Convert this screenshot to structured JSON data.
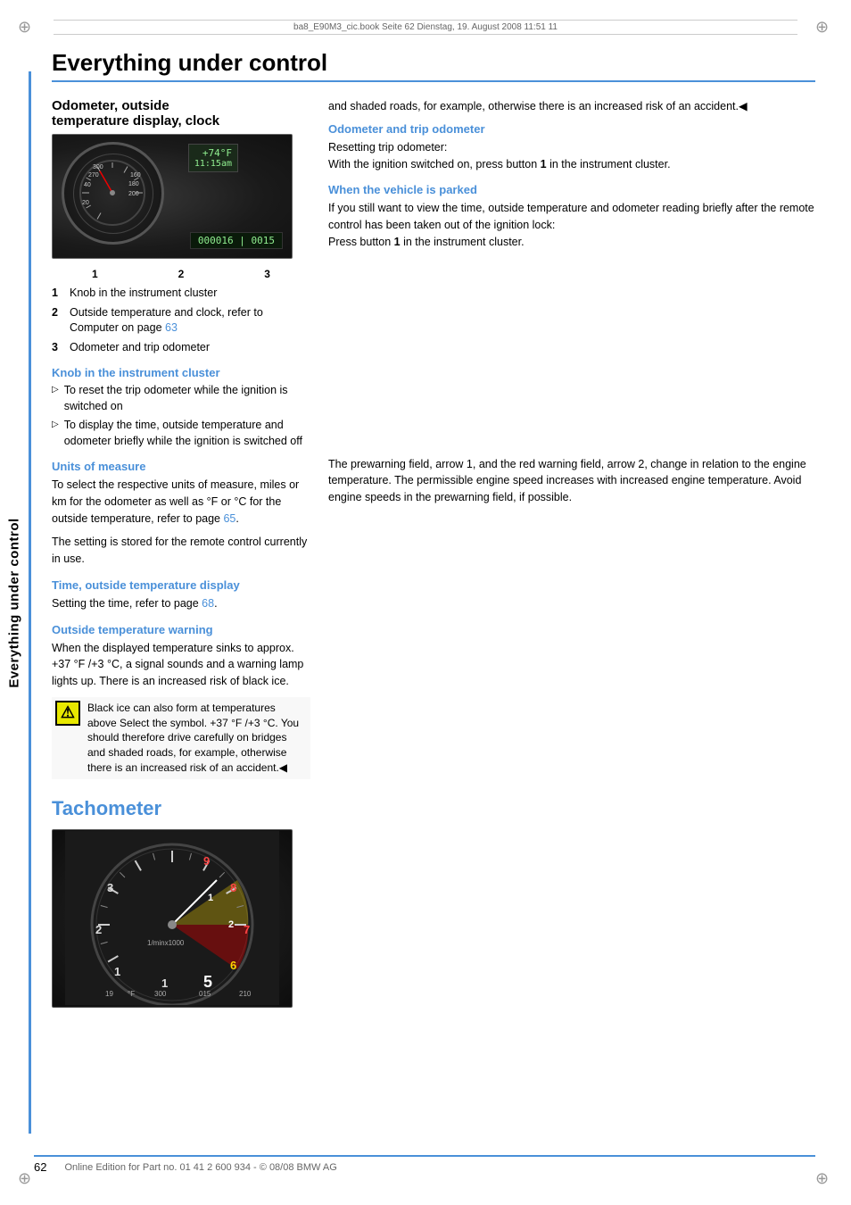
{
  "page": {
    "title": "Everything under control",
    "file_bar": "ba8_E90M3_cic.book  Seite 62  Dienstag, 19. August 2008  11:51 11",
    "page_number": "62",
    "footer_text": "Online Edition for Part no. 01 41 2 600 934 - © 08/08 BMW AG"
  },
  "sidebar": {
    "label": "Everything under control"
  },
  "left_col": {
    "section_title": "Odometer, outside temperature display, clock",
    "image": {
      "digital_temp": "+74°F",
      "digital_time": "11:15am",
      "odometer": "000016 | 0015",
      "labels": [
        "1",
        "2",
        "3"
      ]
    },
    "numbered_items": [
      {
        "num": "1",
        "text": "Knob in the instrument cluster"
      },
      {
        "num": "2",
        "text": "Outside temperature and clock, refer to Computer on page 63"
      },
      {
        "num": "3",
        "text": "Odometer and trip odometer"
      }
    ],
    "knob_section": {
      "heading": "Knob in the instrument cluster",
      "bullets": [
        "To reset the trip odometer while the ignition is switched on",
        "To display the time, outside temperature and odometer briefly while the ignition is switched off"
      ]
    },
    "units_section": {
      "heading": "Units of measure",
      "text": "To select the respective units of measure, miles or km for the odometer as well as °F or °C for the outside temperature, refer to page 65.",
      "text2": "The setting is stored for the remote control currently in use.",
      "page_link": "65"
    },
    "time_section": {
      "heading": "Time, outside temperature display",
      "text": "Setting the time, refer to page 68.",
      "page_link": "68"
    },
    "warning_section": {
      "heading": "Outside temperature warning",
      "text": "When the displayed temperature sinks to approx. +37 °F /+3 °C, a signal sounds and a warning lamp lights up. There is an increased risk of black ice.",
      "warning_box_text": "Black ice can also form at temperatures above Select the symbol. +37 °F /+3 °C. You should therefore drive carefully on bridges and shaded roads, for example, otherwise there is an increased risk of an accident.◀"
    }
  },
  "right_col": {
    "odo_section": {
      "heading": "Odometer and trip odometer",
      "text": "Resetting trip odometer: With the ignition switched on, press button 1 in the instrument cluster."
    },
    "parked_section": {
      "heading": "When the vehicle is parked",
      "text": "If you still want to view the time, outside temperature and odometer reading briefly after the remote control has been taken out of the ignition lock: Press button 1 in the instrument cluster."
    },
    "tacho_section": {
      "title": "Tachometer",
      "text": "The prewarning field, arrow 1, and the red warning field, arrow 2, change in relation to the engine temperature. The permissible engine speed increases with increased engine temperature. Avoid engine speeds in the prewarning field, if possible.",
      "image": {
        "numbers": [
          "1",
          "2",
          "3",
          "5",
          "6",
          "7",
          "8",
          "9"
        ],
        "rpm_label": "1/minx1000",
        "temp_label": "°F",
        "speed_label": "300",
        "odo_label": "015",
        "bottom_num": "210"
      }
    }
  }
}
